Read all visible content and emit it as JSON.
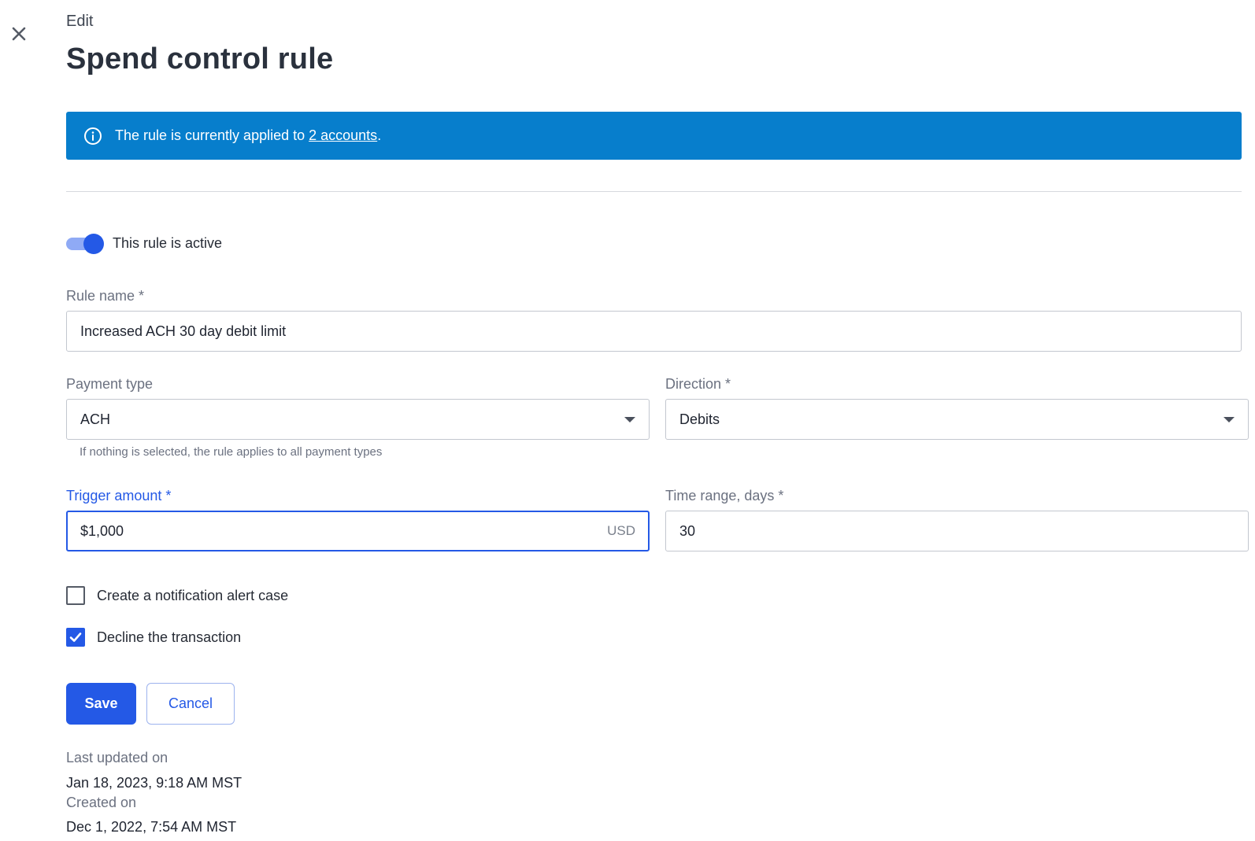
{
  "header": {
    "eyebrow": "Edit",
    "title": "Spend control rule"
  },
  "banner": {
    "text_before": "The rule is currently applied to ",
    "link_text": "2 accounts",
    "text_after": ".",
    "color": "#077ecc"
  },
  "active_toggle": {
    "label": "This rule is active",
    "on": true
  },
  "form": {
    "rule_name": {
      "label": "Rule name *",
      "value": "Increased ACH 30 day debit limit"
    },
    "payment_type": {
      "label": "Payment type",
      "value": "ACH",
      "helper": "If nothing is selected, the rule applies to all payment types"
    },
    "direction": {
      "label": "Direction *",
      "value": "Debits"
    },
    "trigger_amount": {
      "label": "Trigger amount *",
      "value": "$1,000",
      "suffix": "USD"
    },
    "time_range": {
      "label": "Time range, days *",
      "value": "30"
    }
  },
  "options": {
    "notification": {
      "label": "Create a notification alert case",
      "checked": false
    },
    "decline": {
      "label": "Decline the transaction",
      "checked": true
    }
  },
  "actions": {
    "save_label": "Save",
    "cancel_label": "Cancel"
  },
  "meta": {
    "updated_label": "Last updated on",
    "updated_value": "Jan 18, 2023, 9:18 AM MST",
    "created_label": "Created on",
    "created_value": "Dec 1, 2022, 7:54 AM MST"
  },
  "colors": {
    "accent": "#2459e6",
    "banner": "#077ecc"
  },
  "icons": {
    "close": "close-icon",
    "info": "info-icon",
    "dropdown": "chevron-down-icon",
    "check": "check-icon"
  }
}
